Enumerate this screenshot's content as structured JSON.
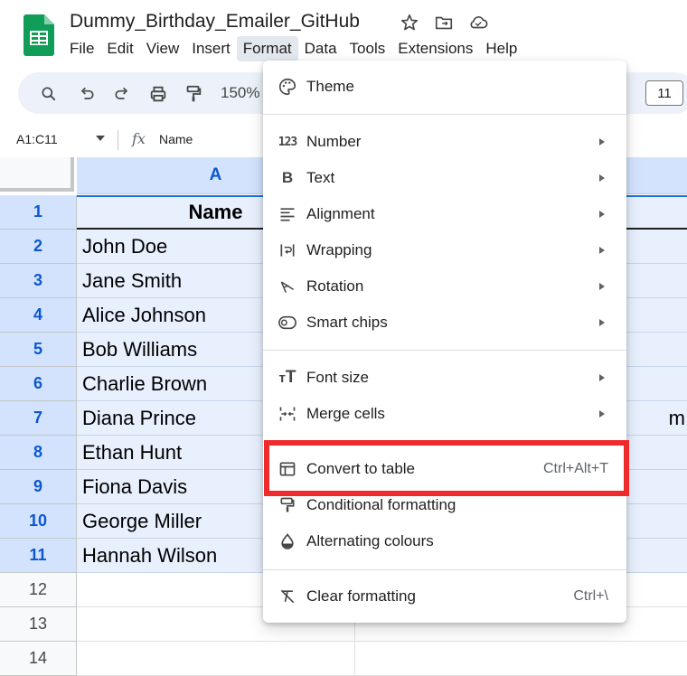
{
  "app": {
    "logo_icon": "sheets-logo-icon",
    "brand_color": "#0f9d58"
  },
  "document": {
    "title": "Dummy_Birthday_Emailer_GitHub"
  },
  "menubar": {
    "items": [
      "File",
      "Edit",
      "View",
      "Insert",
      "Format",
      "Data",
      "Tools",
      "Extensions",
      "Help"
    ],
    "active": "Format"
  },
  "toolbar": {
    "zoom": "150%",
    "minus": "−",
    "font_size": "11"
  },
  "formula_bar": {
    "name_box": "A1:C11",
    "fx": "fx",
    "value": "Name"
  },
  "grid": {
    "columns": [
      {
        "label": "A"
      },
      {
        "label": ""
      }
    ],
    "header_cell": "Name",
    "rows": [
      {
        "num": "1",
        "a": "Name",
        "c": ""
      },
      {
        "num": "2",
        "a": "John Doe",
        "c": ""
      },
      {
        "num": "3",
        "a": "Jane Smith",
        "c": ""
      },
      {
        "num": "4",
        "a": "Alice Johnson",
        "c": ""
      },
      {
        "num": "5",
        "a": "Bob Williams",
        "c": ""
      },
      {
        "num": "6",
        "a": "Charlie Brown",
        "c": ""
      },
      {
        "num": "7",
        "a": "Diana Prince",
        "c": "m"
      },
      {
        "num": "8",
        "a": "Ethan Hunt",
        "c": ""
      },
      {
        "num": "9",
        "a": "Fiona Davis",
        "c": ""
      },
      {
        "num": "10",
        "a": "George Miller",
        "c": ""
      },
      {
        "num": "11",
        "a": "Hannah Wilson",
        "c": ""
      },
      {
        "num": "12",
        "a": "",
        "c": ""
      },
      {
        "num": "13",
        "a": "",
        "c": ""
      },
      {
        "num": "14",
        "a": "",
        "c": ""
      }
    ]
  },
  "format_menu": {
    "items": [
      {
        "label": "Theme",
        "icon": "palette-icon"
      },
      {
        "label": "Number",
        "icon": "number-123-icon",
        "submenu": true
      },
      {
        "label": "Text",
        "icon": "bold-b-icon",
        "submenu": true
      },
      {
        "label": "Alignment",
        "icon": "align-left-icon",
        "submenu": true
      },
      {
        "label": "Wrapping",
        "icon": "text-wrap-icon",
        "submenu": true
      },
      {
        "label": "Rotation",
        "icon": "text-rotation-icon",
        "submenu": true
      },
      {
        "label": "Smart chips",
        "icon": "smart-chips-icon",
        "submenu": true
      },
      {
        "label": "Font size",
        "icon": "font-size-icon",
        "submenu": true
      },
      {
        "label": "Merge cells",
        "icon": "merge-cells-icon",
        "submenu": true
      },
      {
        "label": "Convert to table",
        "icon": "table-icon",
        "shortcut": "Ctrl+Alt+T"
      },
      {
        "label": "Conditional formatting",
        "icon": "paint-roller-icon"
      },
      {
        "label": "Alternating colours",
        "icon": "color-drop-icon"
      },
      {
        "label": "Clear formatting",
        "icon": "clear-format-icon",
        "shortcut": "Ctrl+\\"
      }
    ],
    "highlight_color": "#ee2a2a"
  },
  "colors": {
    "selection": "#d3e3fd",
    "selection_light": "#e8f0fe",
    "accent": "#0b57d0"
  }
}
